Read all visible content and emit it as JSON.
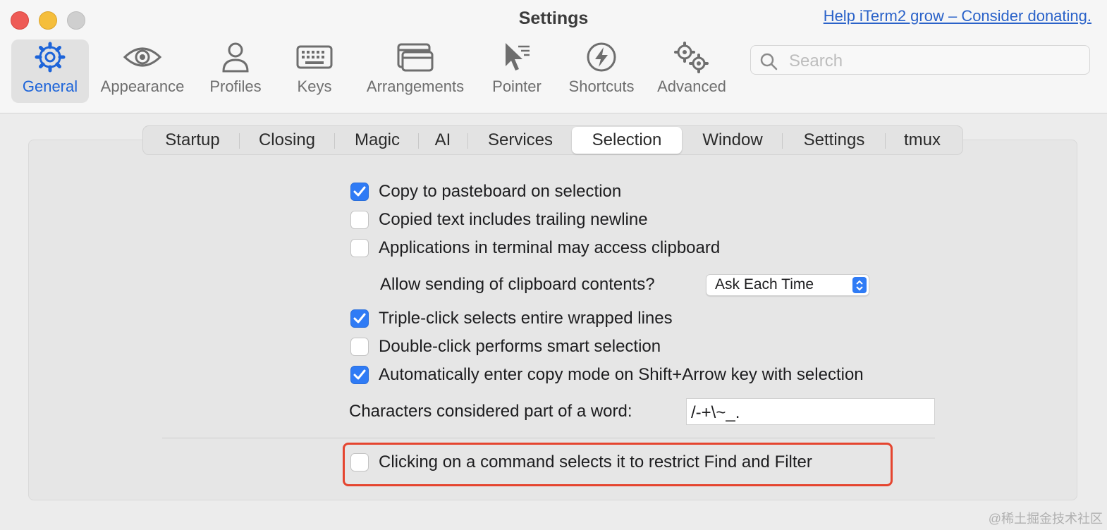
{
  "window": {
    "title": "Settings",
    "donate_link": "Help iTerm2 grow – Consider donating."
  },
  "toolbar": {
    "items": [
      {
        "label": "General",
        "icon": "gear-icon",
        "active": true
      },
      {
        "label": "Appearance",
        "icon": "eye-icon",
        "active": false
      },
      {
        "label": "Profiles",
        "icon": "person-icon",
        "active": false
      },
      {
        "label": "Keys",
        "icon": "keyboard-icon",
        "active": false
      },
      {
        "label": "Arrangements",
        "icon": "windows-icon",
        "active": false
      },
      {
        "label": "Pointer",
        "icon": "pointer-icon",
        "active": false
      },
      {
        "label": "Shortcuts",
        "icon": "bolt-icon",
        "active": false
      },
      {
        "label": "Advanced",
        "icon": "gears-icon",
        "active": false
      }
    ],
    "search_placeholder": "Search"
  },
  "tabs": [
    "Startup",
    "Closing",
    "Magic",
    "AI",
    "Services",
    "Selection",
    "Window",
    "Settings",
    "tmux"
  ],
  "selected_tab": "Selection",
  "options": [
    {
      "label": "Copy to pasteboard on selection",
      "checked": true
    },
    {
      "label": "Copied text includes trailing newline",
      "checked": false
    },
    {
      "label": "Applications in terminal may access clipboard",
      "checked": false
    }
  ],
  "clipboard_sending": {
    "label": "Allow sending of clipboard contents?",
    "value": "Ask Each Time"
  },
  "options2": [
    {
      "label": "Triple-click selects entire wrapped lines",
      "checked": true
    },
    {
      "label": "Double-click performs smart selection",
      "checked": false
    },
    {
      "label": "Automatically enter copy mode on Shift+Arrow key with selection",
      "checked": true
    }
  ],
  "word_chars": {
    "label": "Characters considered part of a word:",
    "value": "/-+\\~_."
  },
  "command_select": {
    "label": "Clicking on a command selects it to restrict Find and Filter",
    "checked": false
  },
  "colors": {
    "accent": "#2f7bf5",
    "highlight_border": "#e5452f",
    "link": "#2a62c9"
  },
  "watermark": "@稀土掘金技术社区"
}
